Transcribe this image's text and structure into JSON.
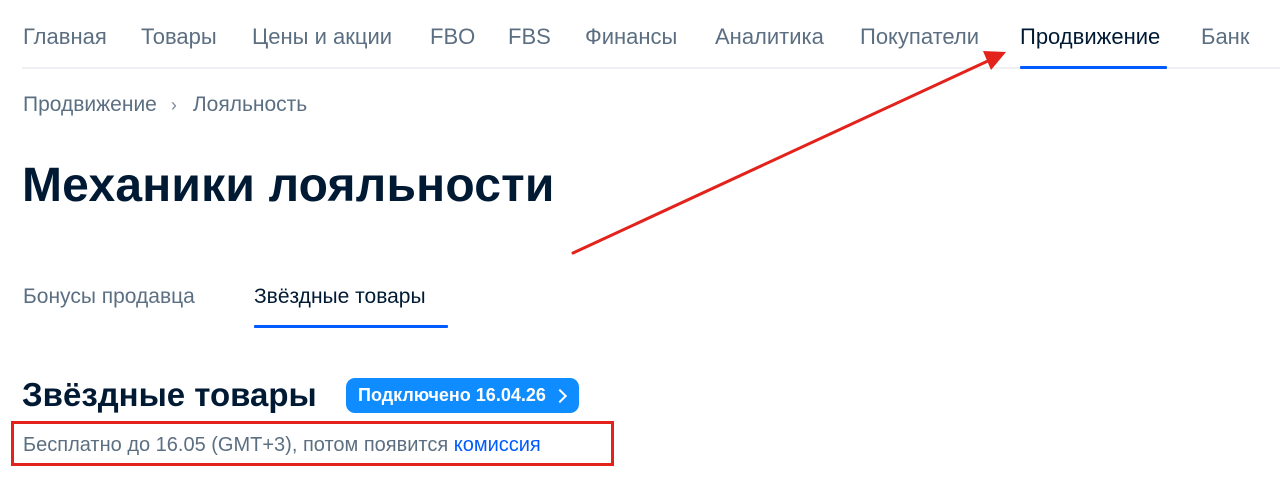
{
  "topnav": {
    "items": [
      {
        "label": "Главная"
      },
      {
        "label": "Товары"
      },
      {
        "label": "Цены и акции"
      },
      {
        "label": "FBO"
      },
      {
        "label": "FBS"
      },
      {
        "label": "Финансы"
      },
      {
        "label": "Аналитика"
      },
      {
        "label": "Покупатели"
      },
      {
        "label": "Продвижение"
      },
      {
        "label": "Банк"
      }
    ],
    "active": "Продвижение"
  },
  "breadcrumb": {
    "items": [
      "Продвижение",
      "Лояльность"
    ],
    "separator": "›"
  },
  "page_title": "Механики лояльности",
  "subtabs": {
    "items": [
      {
        "label": "Бонусы продавца"
      },
      {
        "label": "Звёздные товары"
      }
    ],
    "active": "Звёздные товары"
  },
  "section": {
    "title": "Звёздные товары",
    "badge": "Подключено 16.04.26",
    "info_text": "Бесплатно до 16.05 (GMT+3), потом появится ",
    "info_link": "комиссия"
  },
  "colors": {
    "accent": "#005bff",
    "badge": "#0f8cff",
    "annotation": "#e3221b",
    "text_primary": "#001a34",
    "text_secondary": "#5c6f82"
  },
  "icons": {
    "breadcrumb_separator": "chevron-right-icon",
    "badge_chevron": "chevron-right-icon",
    "annotation": "arrow-annotation"
  }
}
